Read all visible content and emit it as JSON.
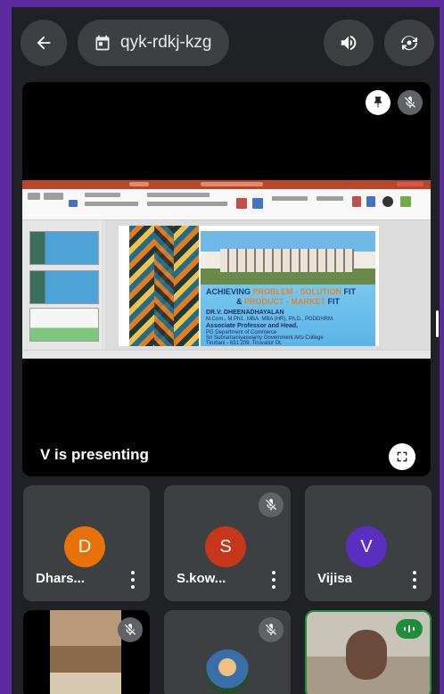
{
  "topbar": {
    "meeting_code": "qyk-rdkj-kzg",
    "icons": [
      "back-arrow-icon",
      "calendar-icon",
      "speaker-icon",
      "camera-switch-icon"
    ]
  },
  "presentation": {
    "presenter_label": "V is presenting",
    "slide": {
      "title_part1": "ACHIEVING ",
      "title_hl1": "PROBLEM - SOLUTION",
      "title_part2": " FIT",
      "title_line2_part1": "& ",
      "title_hl2": "PRODUCT - MARKET",
      "title_line2_part2": " FIT",
      "speaker": "DR.V. DHEENADHAYALAN",
      "speaker_details": "M.Com., M.Phil., MBA, MBA (HR), Ph.D., PGDDHRM.",
      "designation": "Associate Professor and Head,",
      "dept": "PG Department of Commerce",
      "college": "Sri Subramaniyaswamy Government Arts College",
      "place": "Tiruttani - 631 209. Tiruvallur Dt."
    },
    "icons": [
      "pin-icon",
      "mic-off-icon",
      "fullscreen-icon"
    ]
  },
  "participants": [
    {
      "name": "Dhars...",
      "initial": "D",
      "color": "#e8710a",
      "muted": false
    },
    {
      "name": "S.kow...",
      "initial": "S",
      "color": "#c5361b",
      "muted": true
    },
    {
      "name": "Vijisa",
      "initial": "V",
      "color": "#5b2ec2",
      "muted": false
    }
  ],
  "video_tiles": [
    {
      "muted": true
    },
    {
      "muted": true
    },
    {
      "speaking": true
    }
  ]
}
